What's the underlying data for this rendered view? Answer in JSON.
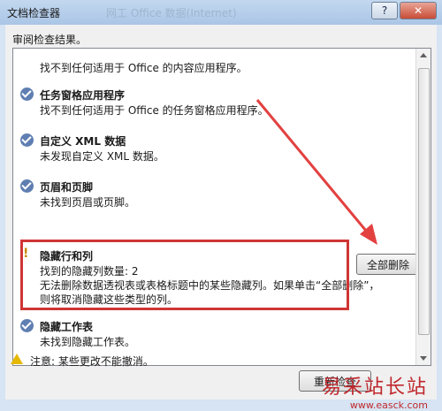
{
  "window": {
    "title": "文档检查器",
    "ghost_title": "网工 Office 数据(Internet)"
  },
  "section_label": "审阅检查结果。",
  "items": [
    {
      "name": "",
      "desc": "找不到任何适用于 Office 的内容应用程序。",
      "status": "ok"
    },
    {
      "name": "任务窗格应用程序",
      "desc": "找不到任何适用于 Office 的任务窗格应用程序。",
      "status": "ok"
    },
    {
      "name": "自定义 XML 数据",
      "desc": "未发现自定义 XML 数据。",
      "status": "ok"
    },
    {
      "name": "页眉和页脚",
      "desc": "未找到页眉或页脚。",
      "status": "ok"
    },
    {
      "name": "隐藏行和列",
      "desc": "找到的隐藏列数量: 2",
      "desc2": "无法删除数据透视表或表格标题中的某些隐藏列。如果单击“全部删除”，",
      "desc3": "则将取消隐藏这些类型的列。",
      "status": "warn"
    },
    {
      "name": "隐藏工作表",
      "desc": "未找到隐藏工作表。",
      "status": "ok"
    }
  ],
  "remove_all_label": "全部删除",
  "notice": "注意: 某些更改不能撤消。",
  "reinspect_label": "重新检查",
  "watermark": {
    "cn": "易采站长站",
    "en": "www.easck.com"
  },
  "colors": {
    "highlight": "#d03535",
    "arrow": "#e34040",
    "check": "#5f7fb2"
  }
}
